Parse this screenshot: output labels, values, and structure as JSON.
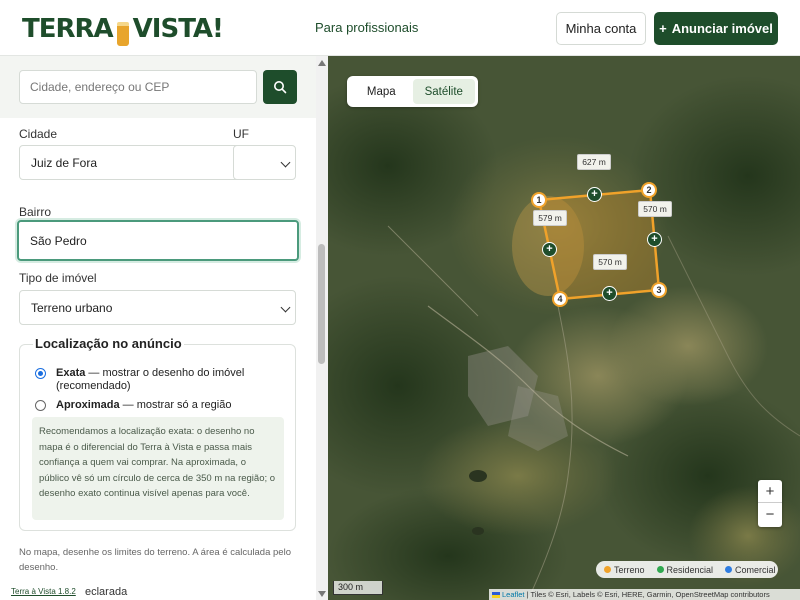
{
  "brand": {
    "left": "TERRA",
    "right": "VISTA!"
  },
  "header": {
    "nav_link": "Para profissionais",
    "account_label": "Minha conta",
    "announce_label": "Anunciar imóvel",
    "announce_plus": "+"
  },
  "search": {
    "placeholder": "Cidade, endereço ou CEP",
    "value": ""
  },
  "form": {
    "city_label": "Cidade",
    "city_value": "Juiz de Fora",
    "uf_label": "UF",
    "uf_value": "",
    "district_label": "Bairro",
    "district_value": "São Pedro",
    "type_label": "Tipo de imóvel",
    "type_value": "Terreno urbano",
    "location_legend": "Localização no anúncio",
    "exact_title": "Exata",
    "exact_desc": "— mostrar o desenho do imóvel",
    "exact_desc2": "(recomendado)",
    "approx_title": "Aproximada",
    "approx_desc": "— mostrar só a região",
    "note": "Recomendamos a localização exata: o desenho no mapa é o diferencial do Terra à Vista e passa mais confiança a quem vai comprar. Na aproximada, o público vê só um círculo de cerca de 350 m na região; o desenho exato continua visível apenas para você.",
    "draw_hint": "No mapa, desenhe os limites do terreno. A área é calculada pelo desenho.",
    "trailing_text": "eclarada"
  },
  "version": "Terra à Vista 1.8.2",
  "map": {
    "tabs": [
      {
        "label": "Mapa",
        "active": false
      },
      {
        "label": "Satélite",
        "active": true
      }
    ],
    "polygon": {
      "vertex_labels": [
        "1",
        "2",
        "3",
        "4"
      ],
      "edge_lengths": [
        "627 m",
        "570 m",
        "570 m",
        "579 m"
      ],
      "stroke_color": "#f0a22a"
    },
    "zoom_in": "+",
    "zoom_out": "−",
    "legend": [
      {
        "label": "Terreno",
        "color": "#f0a22a"
      },
      {
        "label": "Residencial",
        "color": "#2fa84f"
      },
      {
        "label": "Comercial",
        "color": "#2f7de1"
      }
    ],
    "scale_label": "300 m",
    "attribution_leaflet": "Leaflet",
    "attribution_rest": "| Tiles © Esri, Labels © Esri, HERE, Garmin, OpenStreetMap contributors"
  },
  "colors": {
    "brand_green": "#1e4d2b",
    "focus_border": "#4b9a7c",
    "radio_blue": "#1a6ee0"
  }
}
